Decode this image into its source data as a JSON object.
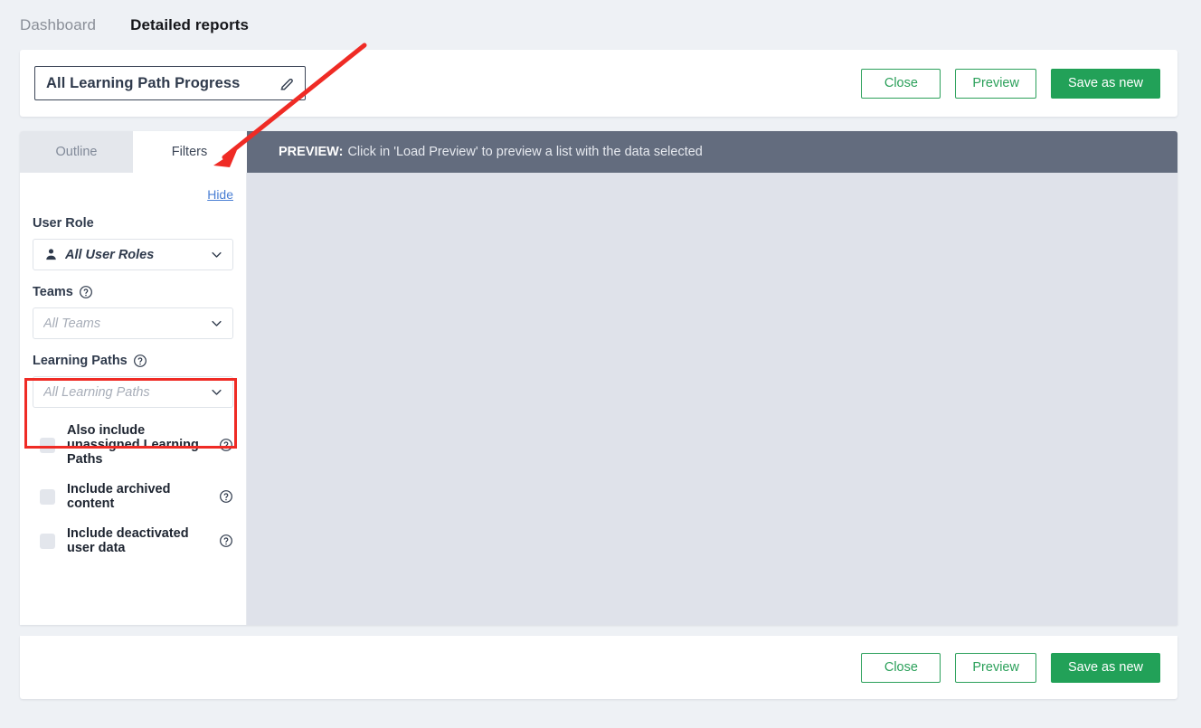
{
  "topnav": {
    "items": [
      {
        "label": "Dashboard",
        "active": false
      },
      {
        "label": "Detailed reports",
        "active": true
      }
    ]
  },
  "header": {
    "report_title": "All Learning Path Progress",
    "edit_icon": "pencil-icon",
    "buttons": {
      "close": "Close",
      "preview": "Preview",
      "save_as_new": "Save as new"
    }
  },
  "tabs": [
    {
      "label": "Outline",
      "active": false
    },
    {
      "label": "Filters",
      "active": true
    }
  ],
  "preview": {
    "prefix": "PREVIEW:",
    "message": "Click in 'Load Preview' to preview a list with the data selected"
  },
  "sidebar": {
    "hide_label": "Hide",
    "fields": [
      {
        "label": "User Role",
        "has_help": false,
        "icon": "person-icon",
        "value": "All User Roles",
        "value_style": "dark"
      },
      {
        "label": "Teams",
        "has_help": true,
        "icon": "",
        "value": "All Teams",
        "value_style": "muted"
      },
      {
        "label": "Learning Paths",
        "has_help": true,
        "icon": "",
        "value": "All Learning Paths",
        "value_style": "muted"
      }
    ],
    "checkboxes": [
      {
        "label": "Also include unassigned Learning Paths",
        "checked": false
      },
      {
        "label": "Include archived content",
        "checked": false
      },
      {
        "label": "Include deactivated user data",
        "checked": false
      }
    ]
  },
  "footer": {
    "buttons": {
      "close": "Close",
      "preview": "Preview",
      "save_as_new": "Save as new"
    }
  },
  "colors": {
    "accent_green": "#22a158",
    "annotation_red": "#ef2b25",
    "preview_bar": "#636c7e",
    "link_blue": "#4a7fd4"
  }
}
